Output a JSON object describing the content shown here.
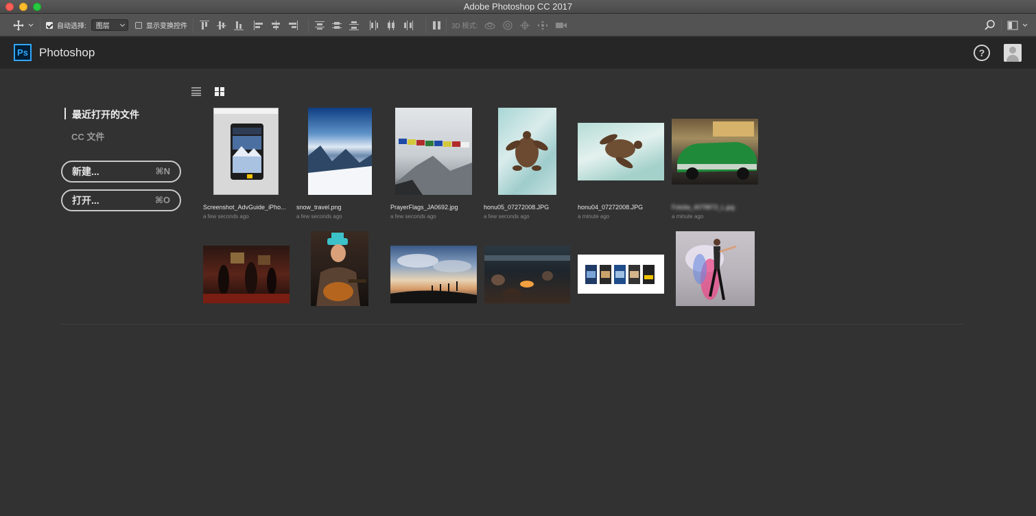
{
  "window": {
    "title": "Adobe Photoshop CC 2017"
  },
  "options_bar": {
    "auto_select_label": "自动选择:",
    "auto_select_value": "图层",
    "show_transform_label": "显示变换控件",
    "mode_3d_label": "3D 模式:"
  },
  "header": {
    "app_name": "Photoshop",
    "logo_text": "Ps",
    "help_symbol": "?"
  },
  "sidebar": {
    "recent_label": "最近打开的文件",
    "cc_label": "CC 文件",
    "new_button": {
      "label": "新建...",
      "shortcut": "⌘N"
    },
    "open_button": {
      "label": "打开...",
      "shortcut": "⌘O"
    }
  },
  "recent_files": [
    {
      "name": "Screenshot_AdvGuide_iPho...",
      "time": "a few seconds ago"
    },
    {
      "name": "snow_travel.png",
      "time": "a few seconds ago"
    },
    {
      "name": "PrayerFlags_JA0692.jpg",
      "time": "a few seconds ago"
    },
    {
      "name": "honu05_07272008.JPG",
      "time": "a few seconds ago"
    },
    {
      "name": "honu04_07272008.JPG",
      "time": "a minute ago"
    },
    {
      "name": "Fotolia_4079873_L.jpg",
      "time": "a minute ago"
    }
  ],
  "colors": {
    "accent": "#31a8ff",
    "background": "#323232",
    "header": "#262626"
  }
}
